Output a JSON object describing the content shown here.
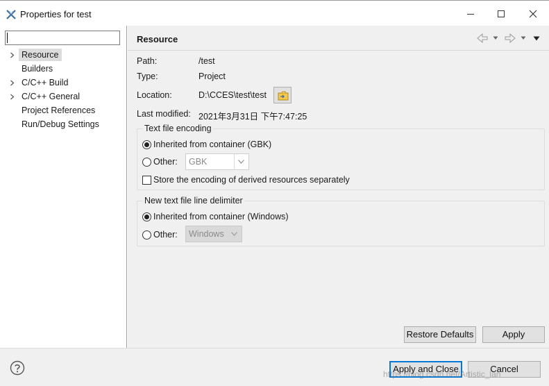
{
  "window": {
    "title": "Properties for test"
  },
  "filter": {
    "value": "",
    "placeholder": ""
  },
  "tree": [
    {
      "label": "Resource",
      "expandable": true,
      "selected": true
    },
    {
      "label": "Builders",
      "expandable": false,
      "selected": false
    },
    {
      "label": "C/C++ Build",
      "expandable": true,
      "selected": false
    },
    {
      "label": "C/C++ General",
      "expandable": true,
      "selected": false
    },
    {
      "label": "Project References",
      "expandable": false,
      "selected": false
    },
    {
      "label": "Run/Debug Settings",
      "expandable": false,
      "selected": false
    }
  ],
  "page": {
    "title": "Resource",
    "path_label": "Path:",
    "path_value": "/test",
    "type_label": "Type:",
    "type_value": "Project",
    "location_label": "Location:",
    "location_value": "D:\\CCES\\test\\test",
    "modified_label": "Last modified:",
    "modified_value": "2021年3月31日 下午7:47:25"
  },
  "encoding": {
    "title": "Text file encoding",
    "inherited_label": "Inherited from container (GBK)",
    "other_label": "Other:",
    "other_value": "GBK",
    "derived_label": "Store the encoding of derived resources separately"
  },
  "delimiter": {
    "title": "New text file line delimiter",
    "inherited_label": "Inherited from container (Windows)",
    "other_label": "Other:",
    "other_value": "Windows"
  },
  "buttons": {
    "restore_defaults": "Restore Defaults",
    "apply": "Apply",
    "apply_close": "Apply and Close",
    "cancel": "Cancel"
  },
  "watermark": "https://blog.csdn.net/Artistic_lan",
  "colors": {
    "focus_border": "#0078d7",
    "selection": "#dcdcdc",
    "panel": "#f0f0f0"
  }
}
